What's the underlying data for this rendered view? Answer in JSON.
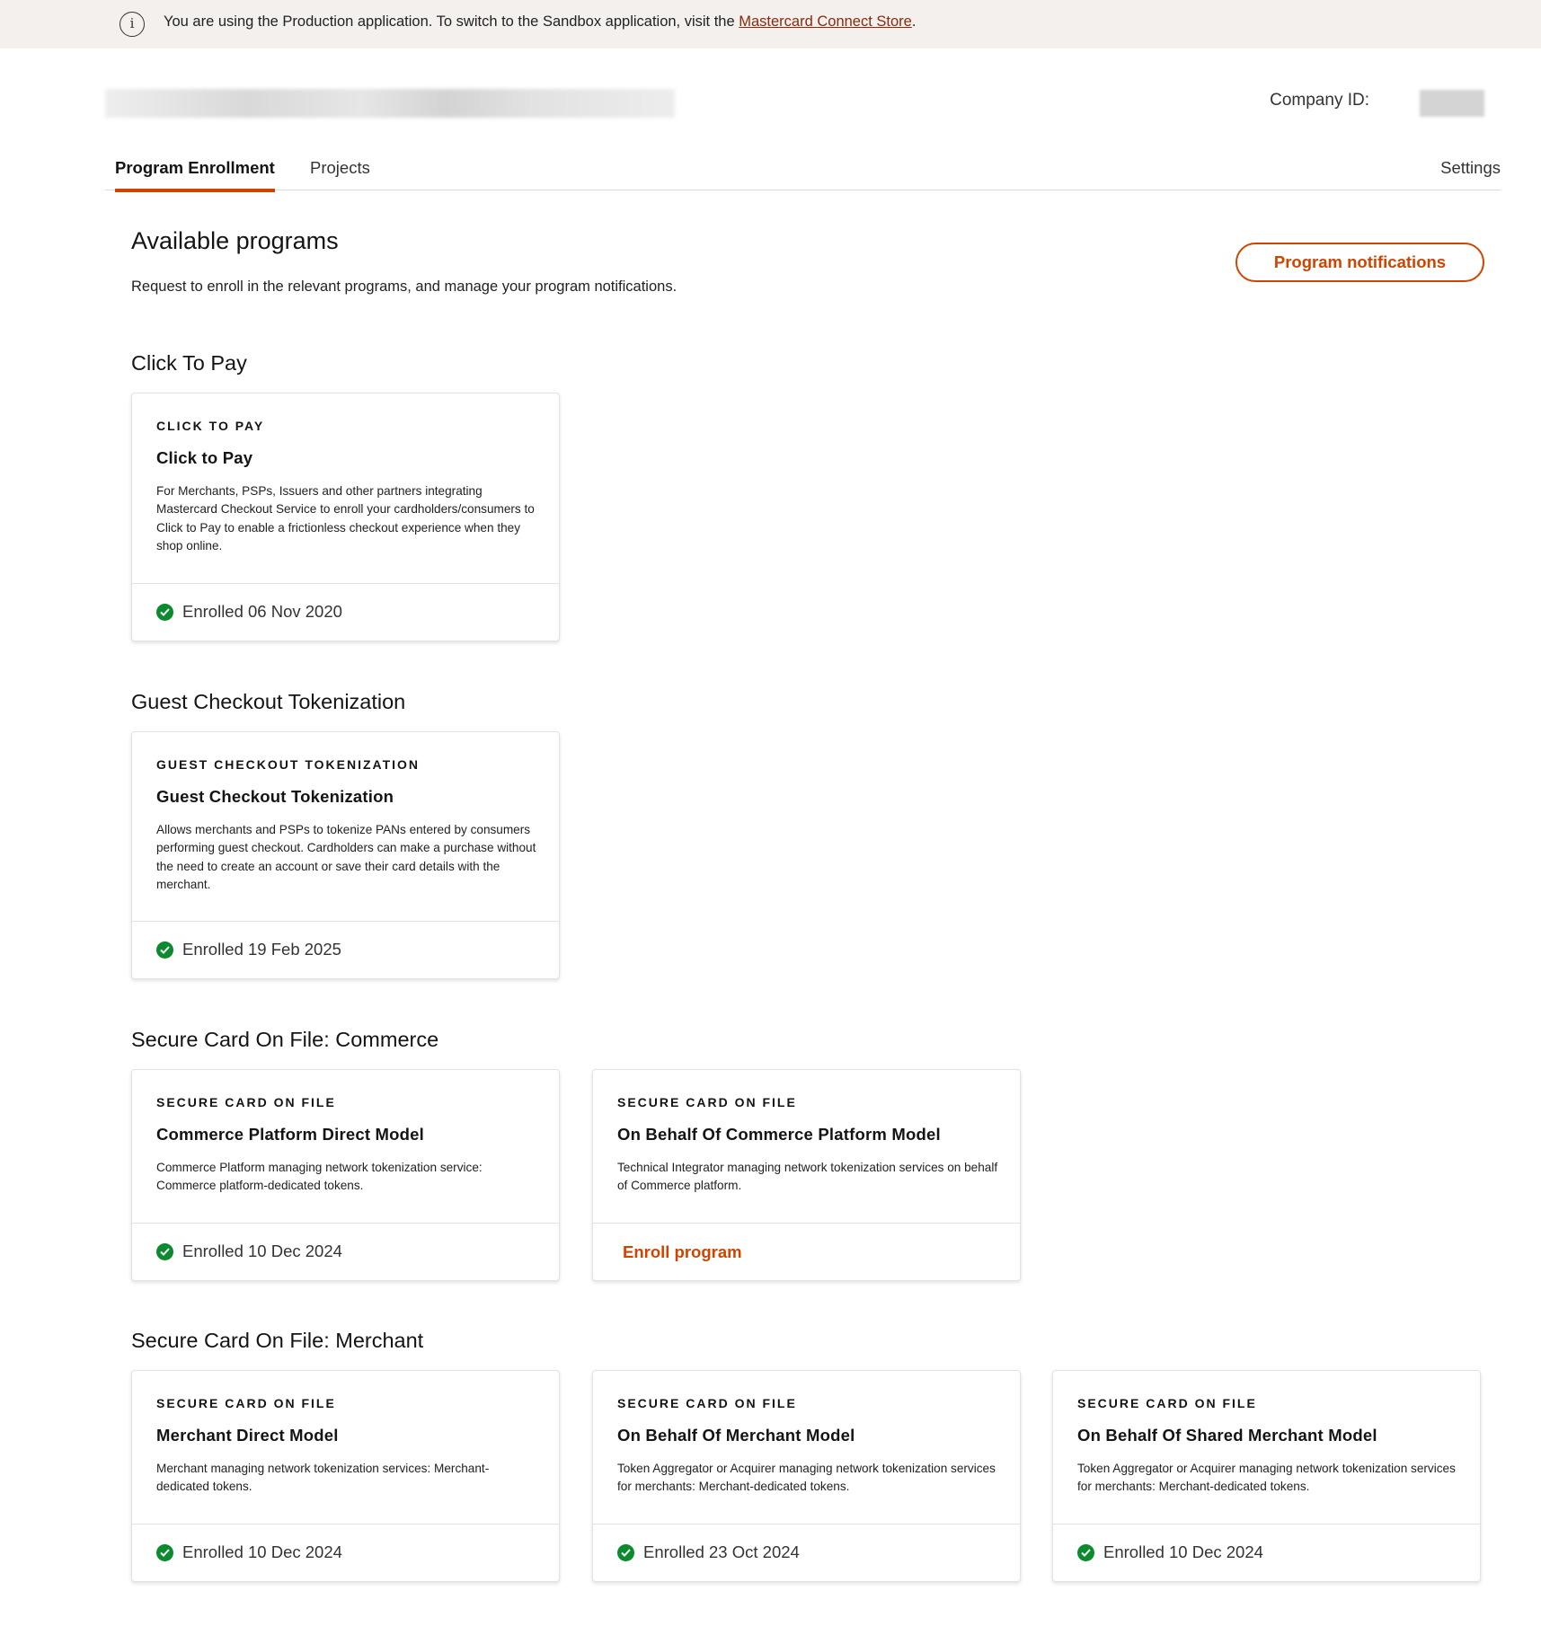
{
  "banner": {
    "text": "You are using the Production application. To switch to the Sandbox application, visit the ",
    "link": "Mastercard Connect Store",
    "suffix": "."
  },
  "header": {
    "company_id_label": "Company ID:"
  },
  "tabs": {
    "program_enrollment": "Program Enrollment",
    "projects": "Projects",
    "settings": "Settings"
  },
  "page": {
    "title": "Available programs",
    "subtitle": "Request to enroll in the relevant programs, and manage your program notifications.",
    "notifications_button": "Program notifications"
  },
  "sections": [
    {
      "title": "Click To Pay",
      "cards": [
        {
          "eyebrow": "CLICK TO PAY",
          "name": "Click to Pay",
          "description": "For Merchants, PSPs, Issuers and other partners integrating Mastercard Checkout Service to enroll your cardholders/consumers to Click to Pay to enable a frictionless checkout experience when they shop online.",
          "status": "Enrolled 06 Nov 2020"
        }
      ]
    },
    {
      "title": "Guest Checkout Tokenization",
      "cards": [
        {
          "eyebrow": "GUEST CHECKOUT TOKENIZATION",
          "name": "Guest Checkout Tokenization",
          "description": "Allows merchants and PSPs to tokenize PANs entered by consumers performing guest checkout. Cardholders can make a purchase without the need to create an account or save their card details with the merchant.",
          "status": "Enrolled 19 Feb 2025"
        }
      ]
    },
    {
      "title": "Secure Card On File: Commerce",
      "cards": [
        {
          "eyebrow": "SECURE CARD ON FILE",
          "name": "Commerce Platform Direct Model",
          "description": "Commerce Platform managing network tokenization service: Commerce platform-dedicated tokens.",
          "status": "Enrolled 10 Dec 2024"
        },
        {
          "eyebrow": "SECURE CARD ON FILE",
          "name": "On Behalf Of Commerce Platform Model",
          "description": "Technical Integrator managing network tokenization services on behalf of Commerce platform.",
          "action": "Enroll program"
        }
      ]
    },
    {
      "title": "Secure Card On File: Merchant",
      "cards": [
        {
          "eyebrow": "SECURE CARD ON FILE",
          "name": "Merchant Direct Model",
          "description": "Merchant managing network tokenization services: Merchant-dedicated tokens.",
          "status": "Enrolled 10 Dec 2024"
        },
        {
          "eyebrow": "SECURE CARD ON FILE",
          "name": "On Behalf Of Merchant Model",
          "description": "Token Aggregator or Acquirer managing network tokenization services for merchants: Merchant-dedicated tokens.",
          "status": "Enrolled 23 Oct 2024"
        },
        {
          "eyebrow": "SECURE CARD ON FILE",
          "name": "On Behalf Of Shared Merchant Model",
          "description": "Token Aggregator or Acquirer managing network tokenization services for merchants: Merchant-dedicated tokens.",
          "status": "Enrolled 10 Dec 2024"
        }
      ]
    }
  ],
  "colors": {
    "accent": "#cf4500",
    "success": "#0c8a2f",
    "banner_bg": "#f3f0ee"
  },
  "icons": {
    "banner": "info-icon",
    "enrolled": "check-circle-icon"
  }
}
